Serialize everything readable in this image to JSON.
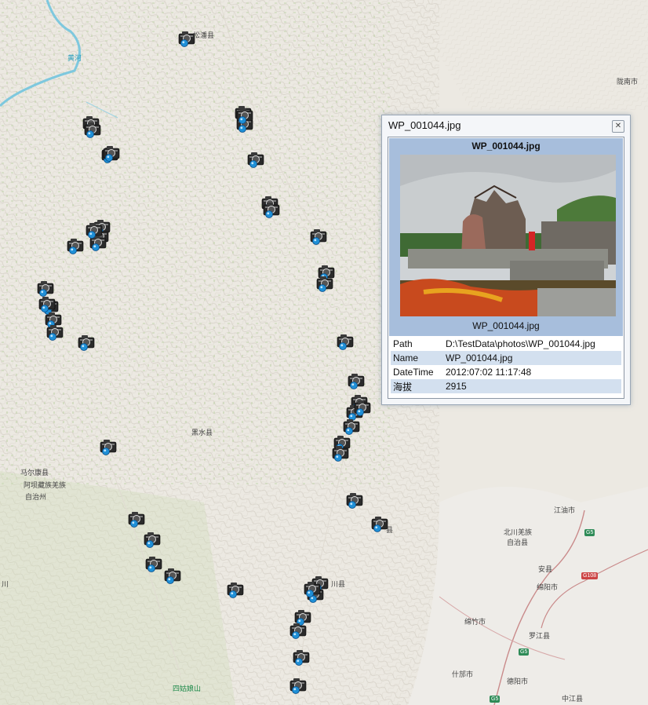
{
  "map": {
    "labels": [
      {
        "name": "label-xiaojin",
        "text": "松潘县",
        "cls": ""
      },
      {
        "name": "label-heihe",
        "text": "黄河",
        "cls": "water"
      },
      {
        "name": "label-longnan",
        "text": "陇南市",
        "cls": ""
      },
      {
        "name": "label-heishui",
        "text": "黑水县",
        "cls": ""
      },
      {
        "name": "label-maerkang",
        "text": "马尔康县",
        "cls": ""
      },
      {
        "name": "label-aba1",
        "text": "阿坝藏族羌族",
        "cls": ""
      },
      {
        "name": "label-aba2",
        "text": "自治州",
        "cls": ""
      },
      {
        "name": "label-jiangyou",
        "text": "江油市",
        "cls": ""
      },
      {
        "name": "label-beichuan1",
        "text": "北川羌族",
        "cls": ""
      },
      {
        "name": "label-beichuan2",
        "text": "自治县",
        "cls": ""
      },
      {
        "name": "label-anxian",
        "text": "安县",
        "cls": ""
      },
      {
        "name": "label-mianyang",
        "text": "绵阳市",
        "cls": ""
      },
      {
        "name": "label-mianzhu",
        "text": "绵竹市",
        "cls": ""
      },
      {
        "name": "label-luojiang",
        "text": "罗江县",
        "cls": ""
      },
      {
        "name": "label-shifang",
        "text": "什邡市",
        "cls": ""
      },
      {
        "name": "label-deyang",
        "text": "德阳市",
        "cls": ""
      },
      {
        "name": "label-zhongjiang",
        "text": "中江县",
        "cls": ""
      },
      {
        "name": "label-siguniang",
        "text": "四姑娘山",
        "cls": "park"
      },
      {
        "name": "label-wenchuan",
        "text": "川县",
        "cls": ""
      },
      {
        "name": "label-li",
        "text": "川",
        "cls": ""
      },
      {
        "name": "label-mao",
        "text": "县",
        "cls": ""
      }
    ],
    "shields": [
      {
        "name": "shield-g5-north",
        "text": "G5",
        "cls": ""
      },
      {
        "name": "shield-g108",
        "text": "G108",
        "cls": "red"
      },
      {
        "name": "shield-g5-south",
        "text": "G5",
        "cls": ""
      },
      {
        "name": "shield-g5-bottom",
        "text": "G5",
        "cls": ""
      }
    ],
    "marker_icon": "camera-icon",
    "photo_marker_count": 48
  },
  "popup": {
    "title": "WP_001044.jpg",
    "close_icon": "close-icon",
    "image_header": "WP_001044.jpg",
    "image_caption": "WP_001044.jpg",
    "attributes": [
      {
        "key": "Path",
        "value": "D:\\TestData\\photos\\WP_001044.jpg"
      },
      {
        "key": "Name",
        "value": "WP_001044.jpg"
      },
      {
        "key": "DateTime",
        "value": "2012:07:02 11:17:48"
      },
      {
        "key": "海拔",
        "value": "2915"
      }
    ]
  },
  "colors": {
    "terrain": "#ece9e2",
    "forest": "#cfdcb8",
    "water": "#7ec8de",
    "popup_header": "#a7bedc",
    "row_alt": "#d3e0ef",
    "marker_blue": "#1f8fd6"
  }
}
